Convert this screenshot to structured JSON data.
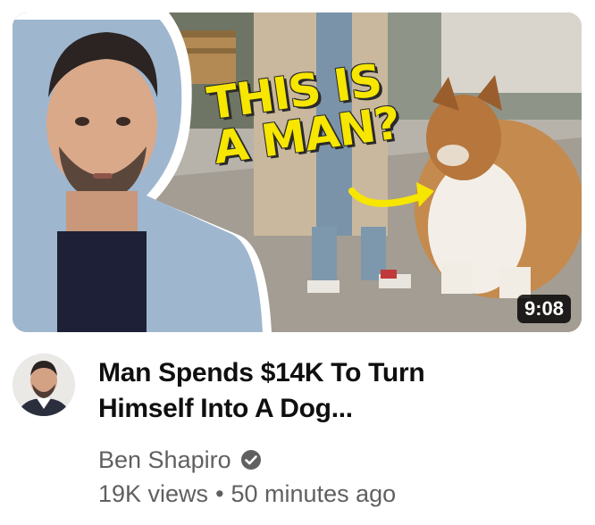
{
  "video": {
    "duration": "9:08",
    "thumbnail_text": [
      "THIS IS",
      "A MAN?"
    ],
    "title_lines": [
      "Man Spends $14K To Turn",
      "Himself Into A Dog..."
    ],
    "channel_name": "Ben Shapiro",
    "views": "19K views",
    "separator": "•",
    "age": "50 minutes ago"
  },
  "colors": {
    "overlay_text": "#f6e600",
    "title": "#0f0f0f",
    "secondary": "#606060",
    "duration_bg": "#000000"
  }
}
